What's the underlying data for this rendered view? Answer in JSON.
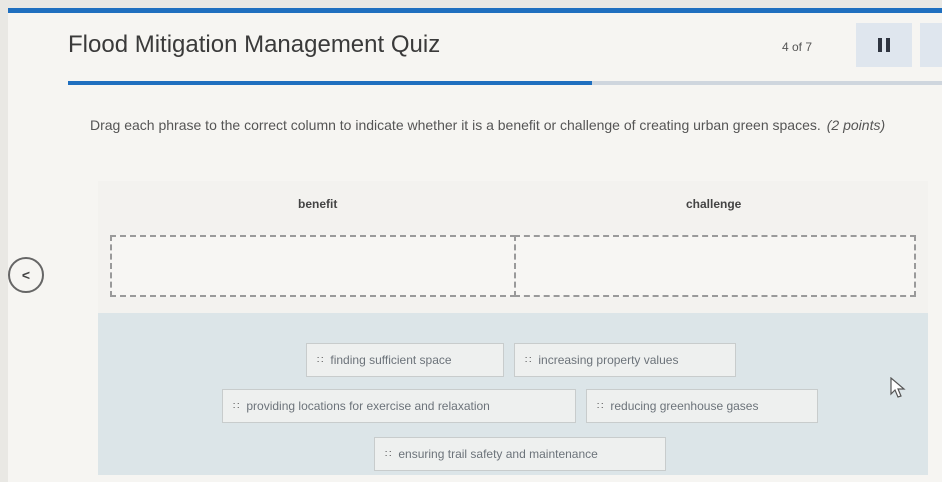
{
  "header": {
    "title": "Flood Mitigation Management Quiz",
    "counter": "4 of 7",
    "progress_fraction": 0.6
  },
  "question": {
    "instructions": "Drag each phrase to the correct column to indicate whether it is a benefit or challenge of creating urban green spaces.",
    "points": "(2 points)"
  },
  "columns": [
    {
      "label": "benefit"
    },
    {
      "label": "challenge"
    }
  ],
  "phrases": [
    "finding sufficient space",
    "increasing property values",
    "providing locations for exercise and relaxation",
    "reducing greenhouse gases",
    "ensuring trail safety and maintenance"
  ],
  "icons": {
    "pause": "pause-icon",
    "back": "chevron-left-icon",
    "grip": "drag-handle-icon",
    "cursor": "mouse-pointer-icon"
  },
  "colors": {
    "accent": "#1f6fbf",
    "bank_background": "#dce5e8"
  }
}
